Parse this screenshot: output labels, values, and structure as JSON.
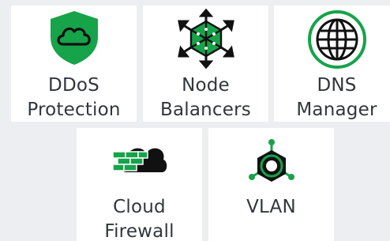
{
  "products": [
    {
      "line1": "DDoS",
      "line2": "Protection",
      "icon": "shield-cloud-icon"
    },
    {
      "line1": "Node",
      "line2": "Balancers",
      "icon": "node-balancer-icon"
    },
    {
      "line1": "DNS",
      "line2": "Manager",
      "icon": "globe-icon"
    },
    {
      "line1": "Cloud",
      "line2": "Firewall",
      "icon": "cloud-firewall-icon"
    },
    {
      "line1": "VLAN",
      "line2": "",
      "icon": "vlan-icon"
    }
  ],
  "colors": {
    "brand_green": "#16a34a",
    "dark": "#32363c",
    "tile_bg": "#ffffff",
    "page_bg": "#eceef1"
  }
}
